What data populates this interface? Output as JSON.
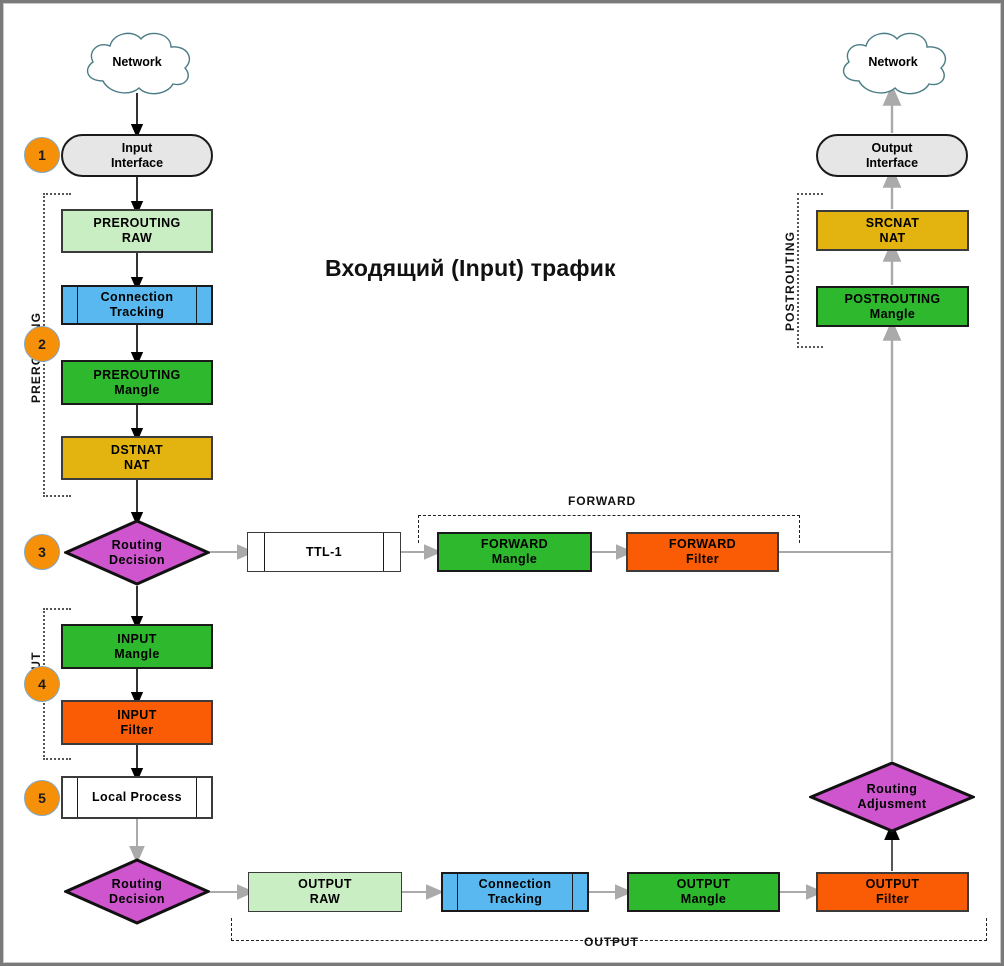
{
  "title": "Входящий (Input) трафик",
  "clouds": [
    {
      "name": "network-in",
      "label": "Network"
    },
    {
      "name": "network-out",
      "label": "Network"
    }
  ],
  "interfaces": [
    {
      "name": "input-interface",
      "label": "Input\nInterface"
    },
    {
      "name": "output-interface",
      "label": "Output\nInterface"
    }
  ],
  "badges": [
    {
      "step": "1"
    },
    {
      "step": "2"
    },
    {
      "step": "3"
    },
    {
      "step": "4"
    },
    {
      "step": "5"
    }
  ],
  "chain_labels": {
    "prerouting": "PREROUTING",
    "input": "INPUT",
    "forward": "FORWARD",
    "output": "OUTPUT",
    "postrouting": "POSTROUTING"
  },
  "nodes": {
    "prerouting_raw": {
      "label": "PREROUTING\nRAW",
      "kind": "raw"
    },
    "conntrack_in": {
      "label": "Connection\nTracking",
      "kind": "conntrack"
    },
    "prerouting_mangle": {
      "label": "PREROUTING\nMangle",
      "kind": "mangle"
    },
    "dstnat": {
      "label": "DSTNAT\nNAT",
      "kind": "nat"
    },
    "routing_decision_1": {
      "label": "Routing\nDecision",
      "kind": "decision"
    },
    "ttl": {
      "label": "TTL-1",
      "kind": "plain"
    },
    "forward_mangle": {
      "label": "FORWARD\nMangle",
      "kind": "mangle"
    },
    "forward_filter": {
      "label": "FORWARD\nFilter",
      "kind": "filter"
    },
    "input_mangle": {
      "label": "INPUT\nMangle",
      "kind": "mangle"
    },
    "input_filter": {
      "label": "INPUT\nFilter",
      "kind": "filter"
    },
    "local_process": {
      "label": "Local Process",
      "kind": "plain"
    },
    "routing_decision_2": {
      "label": "Routing\nDecision",
      "kind": "decision"
    },
    "output_raw": {
      "label": "OUTPUT\nRAW",
      "kind": "raw"
    },
    "conntrack_out": {
      "label": "Connection\nTracking",
      "kind": "conntrack"
    },
    "output_mangle": {
      "label": "OUTPUT\nMangle",
      "kind": "mangle"
    },
    "output_filter": {
      "label": "OUTPUT\nFilter",
      "kind": "filter"
    },
    "routing_adjustment": {
      "label": "Routing\nAdjusment",
      "kind": "decision"
    },
    "postrouting_mangle": {
      "label": "POSTROUTING\nMangle",
      "kind": "mangle"
    },
    "srcnat": {
      "label": "SRCNAT\nNAT",
      "kind": "nat"
    }
  },
  "colors": {
    "raw": "#caeec4",
    "mangle": "#2eb82e",
    "nat": "#e3b40f",
    "filter": "#fa5c05",
    "conntrack": "#58b8ef",
    "decision": "#c council",
    "decision_fill": "#ce55ce",
    "interface": "#e6e6e6",
    "badge": "#f79009",
    "cloud_stroke": "#4a7c86",
    "wire_black": "#000000",
    "wire_gray": "#aaaaaa"
  }
}
